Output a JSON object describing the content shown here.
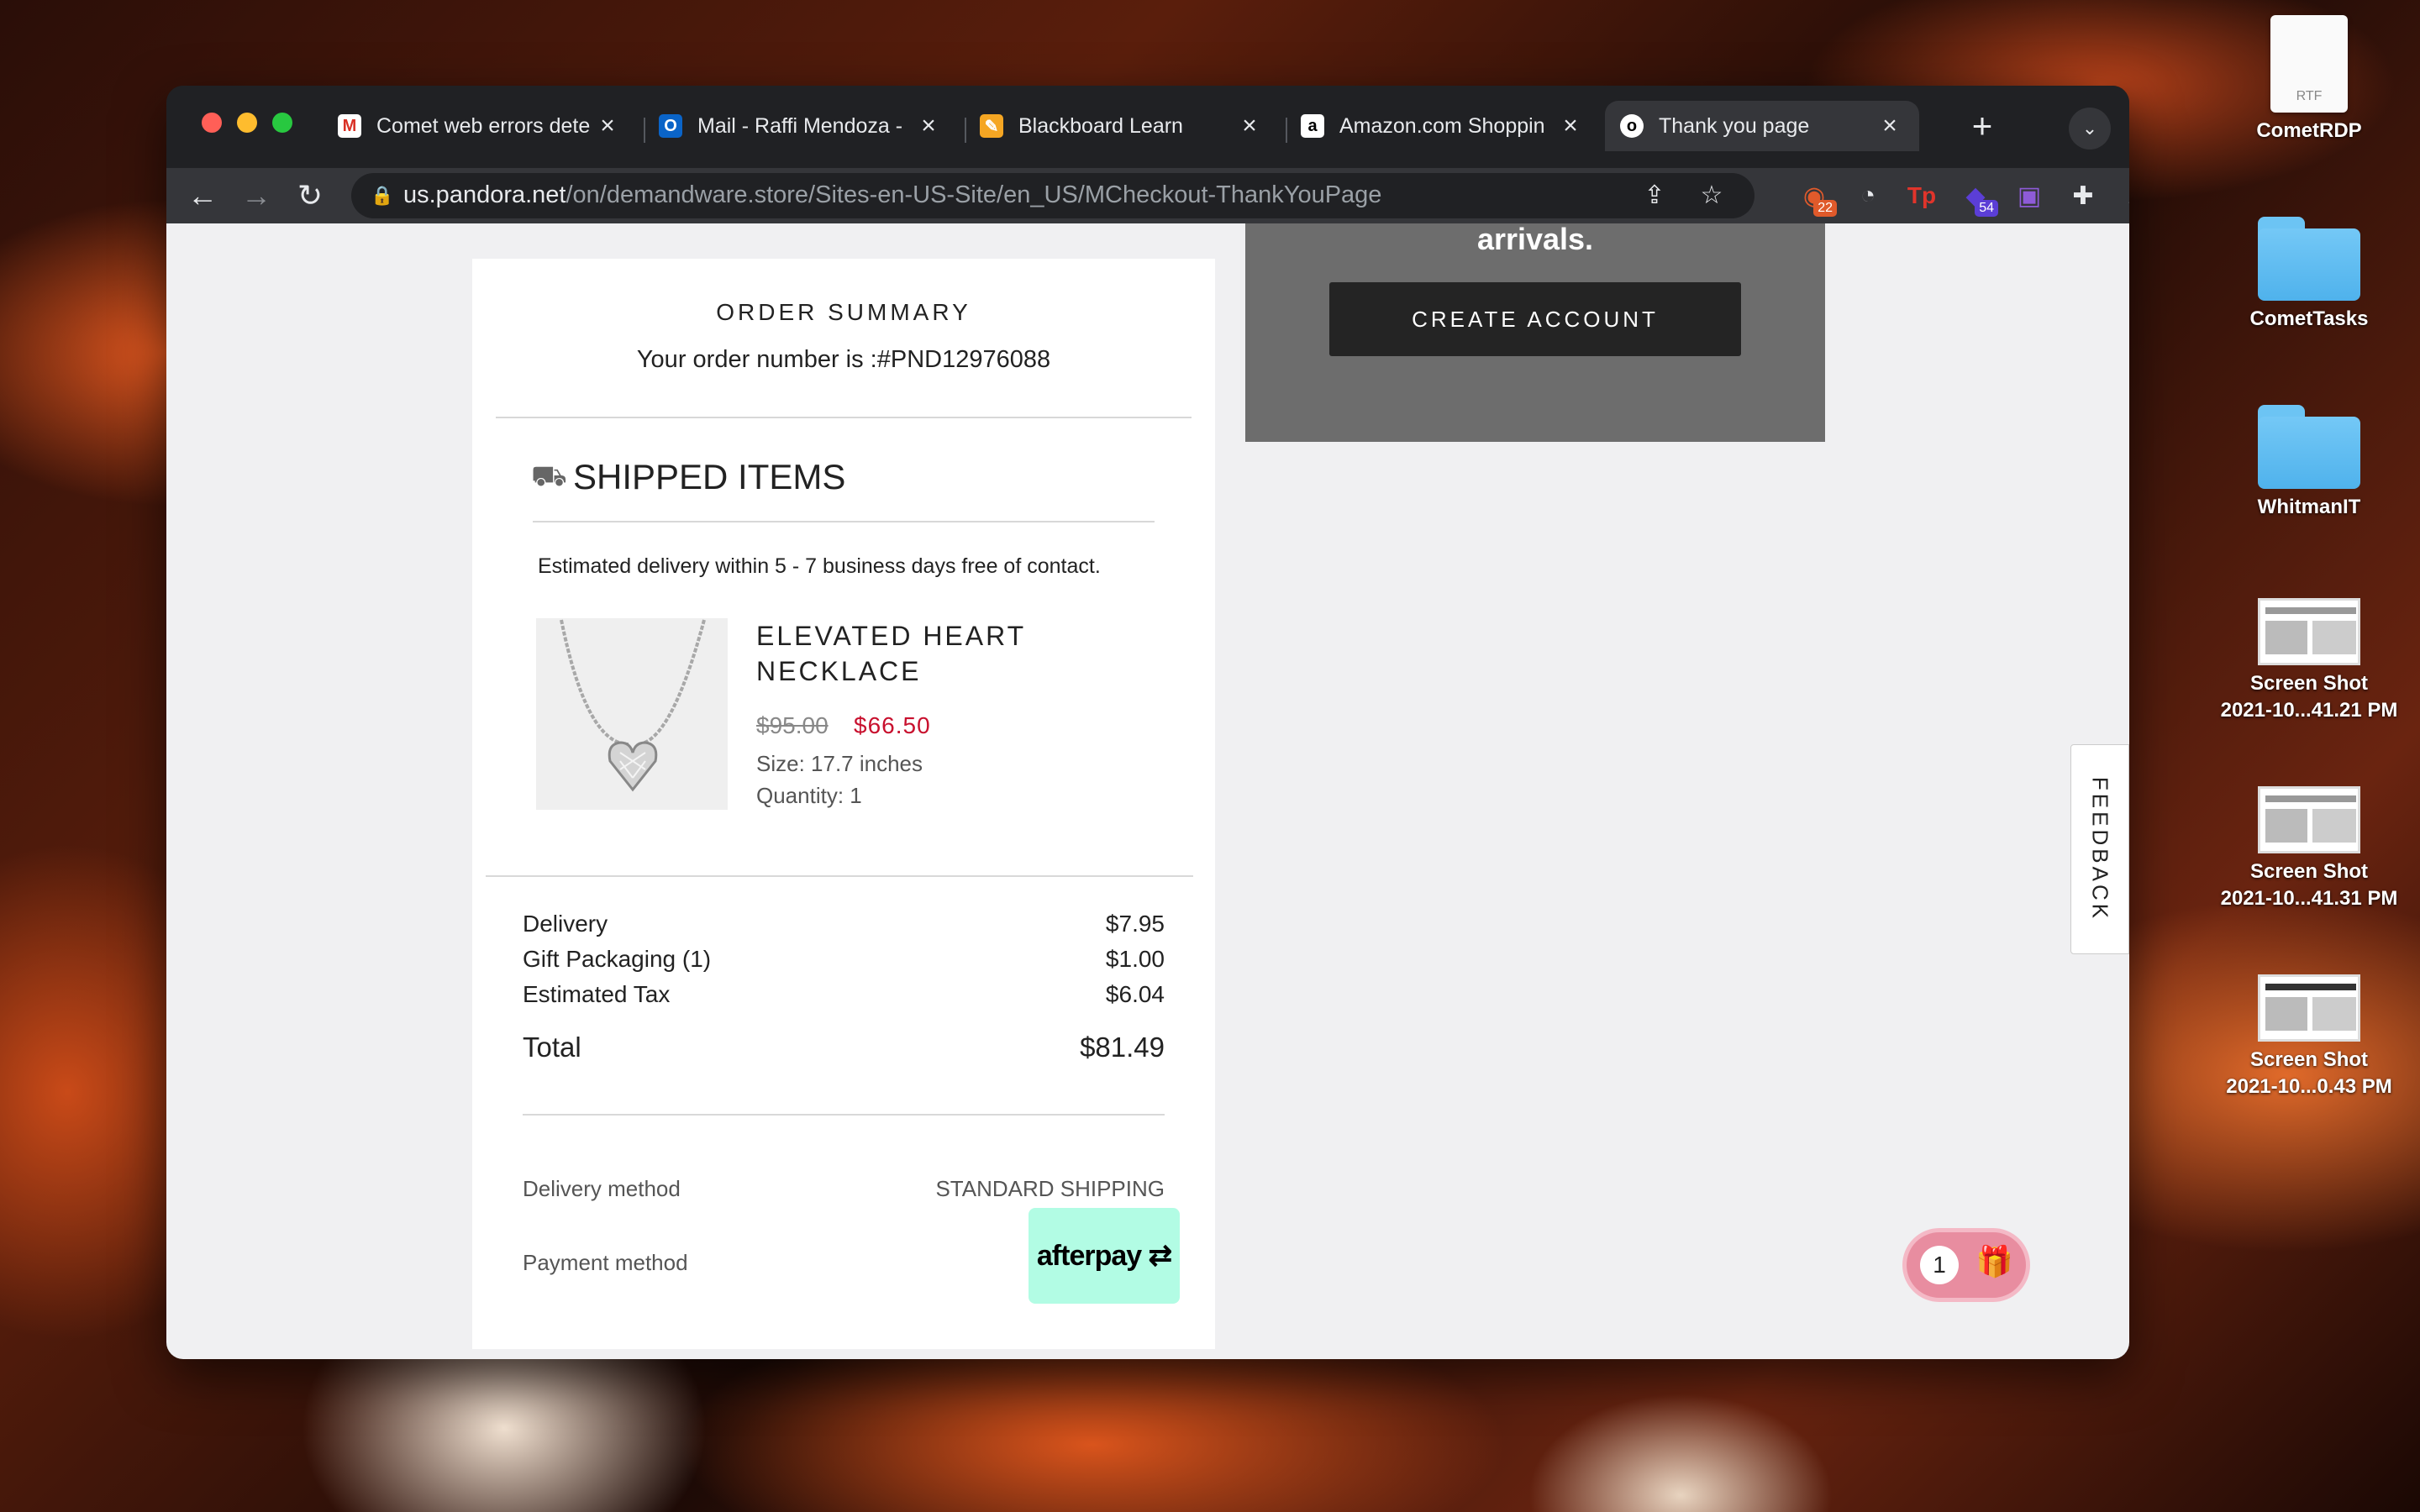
{
  "tabs": [
    {
      "title": "Comet web errors dete",
      "favicon": "gmail-icon"
    },
    {
      "title": "Mail - Raffi Mendoza -",
      "favicon": "outlook-icon"
    },
    {
      "title": "Blackboard Learn",
      "favicon": "blackboard-icon"
    },
    {
      "title": "Amazon.com Shoppin",
      "favicon": "amazon-icon"
    },
    {
      "title": "Thank you page",
      "favicon": "pandora-icon"
    }
  ],
  "address_bar": {
    "host": "us.pandora.net",
    "path": "/on/demandware.store/Sites-en-US-Site/en_US/MCheckout-ThankYouPage"
  },
  "extensions": {
    "badge1": "22",
    "badge2": "54"
  },
  "promo": {
    "text": "arrivals.",
    "button": "CREATE ACCOUNT"
  },
  "order": {
    "title": "ORDER SUMMARY",
    "number_text": "Your order number is :#PND12976088",
    "shipped_title": "SHIPPED ITEMS",
    "estimate": "Estimated delivery within 5 - 7 business days free of contact.",
    "item": {
      "name": "ELEVATED HEART NECKLACE",
      "old_price": "$95.00",
      "price": "$66.50",
      "size": "Size: 17.7 inches",
      "quantity": "Quantity: 1"
    },
    "summary": [
      {
        "label": "Delivery",
        "value": "$7.95"
      },
      {
        "label": "Gift Packaging (1)",
        "value": "$1.00"
      },
      {
        "label": "Estimated Tax",
        "value": "$6.04"
      }
    ],
    "total": {
      "label": "Total",
      "value": "$81.49"
    },
    "delivery_method": {
      "label": "Delivery method",
      "value": "STANDARD SHIPPING"
    },
    "payment_method": {
      "label": "Payment method",
      "value": "afterpay"
    }
  },
  "feedback": "FEEDBACK",
  "gift_count": "1",
  "desktop": [
    {
      "label": "CometRDP",
      "kind": "rtf",
      "type_text": "RTF"
    },
    {
      "label": "CometTasks",
      "kind": "folder"
    },
    {
      "label": "WhitmanIT",
      "kind": "folder"
    },
    {
      "label1": "Screen Shot",
      "label2": "2021-10...41.21 PM",
      "kind": "screenshot"
    },
    {
      "label1": "Screen Shot",
      "label2": "2021-10...41.31 PM",
      "kind": "screenshot"
    },
    {
      "label1": "Screen Shot",
      "label2": "2021-10...0.43 PM",
      "kind": "screenshot"
    }
  ]
}
